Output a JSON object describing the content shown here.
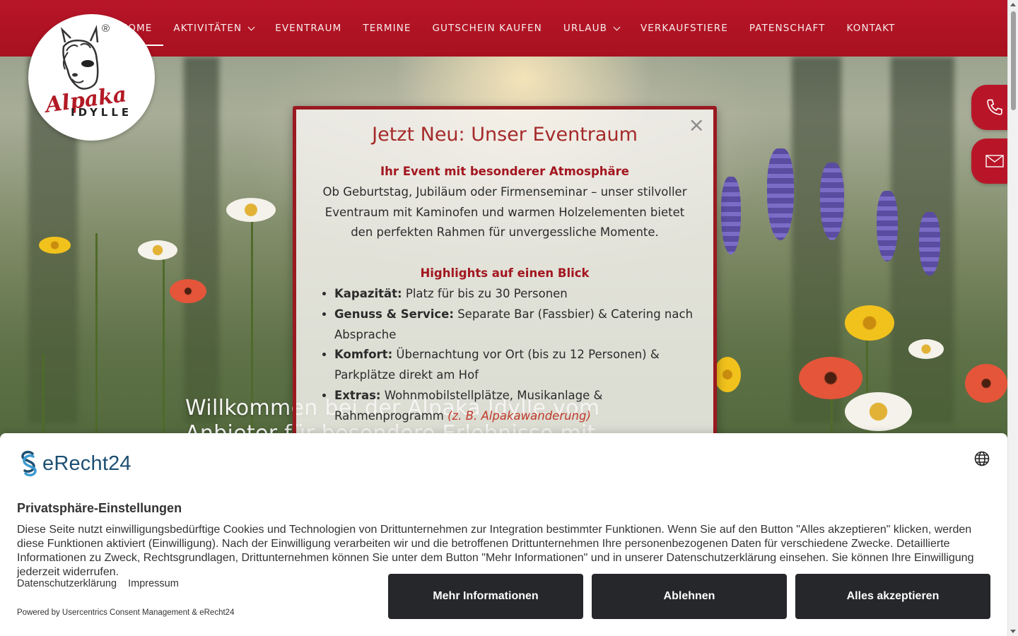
{
  "nav": {
    "items": [
      {
        "label": "HOME",
        "active": true,
        "has_dropdown": false
      },
      {
        "label": "AKTIVITÄTEN",
        "active": false,
        "has_dropdown": true
      },
      {
        "label": "EVENTRAUM",
        "active": false,
        "has_dropdown": false
      },
      {
        "label": "TERMINE",
        "active": false,
        "has_dropdown": false
      },
      {
        "label": "GUTSCHEIN KAUFEN",
        "active": false,
        "has_dropdown": false
      },
      {
        "label": "URLAUB",
        "active": false,
        "has_dropdown": true
      },
      {
        "label": "VERKAUFSTIERE",
        "active": false,
        "has_dropdown": false
      },
      {
        "label": "PATENSCHAFT",
        "active": false,
        "has_dropdown": false
      },
      {
        "label": "KONTAKT",
        "active": false,
        "has_dropdown": false
      }
    ]
  },
  "logo": {
    "word": "Alpaka",
    "sub": "IDYLLE",
    "reg": "®"
  },
  "side_buttons": {
    "phone_icon": "phone-icon",
    "mail_icon": "mail-icon"
  },
  "hero": {
    "line1": "Willkommen bei der Alpaka Idylle vom",
    "line2": "Anbieter für besondere Erlebnisse mit"
  },
  "popup": {
    "close": "×",
    "title": "Jetzt Neu: Unser Eventraum",
    "subtitle": "Ihr Event mit besonderer Atmosphäre",
    "intro": "Ob Geburtstag, Jubiläum oder Firmenseminar – unser stilvoller Eventraum mit Kaminofen und warmen Holzelementen bietet den perfekten Rahmen für unvergessliche Momente.",
    "highlights_title": "Highlights auf einen Blick",
    "highlights": [
      {
        "label": "Kapazität:",
        "text": "Platz für bis zu 30 Personen",
        "extra": ""
      },
      {
        "label": "Genuss & Service:",
        "text": "Separate Bar (Fassbier) & Catering nach Absprache",
        "extra": ""
      },
      {
        "label": "Komfort:",
        "text": "Übernachtung vor Ort (bis zu 12 Personen) & Parkplätze direkt am Hof",
        "extra": ""
      },
      {
        "label": "Extras:",
        "text": "Wohnmobilstellplätze, Musikanlage & Rahmenprogramm",
        "extra": "(z. B. Alpakawanderung)"
      }
    ]
  },
  "consent": {
    "brand": "eRecht24",
    "title": "Privatsphäre-Einstellungen",
    "text": "Diese Seite nutzt einwilligungsbedürftige Cookies und Technologien von Drittunternehmen zur Integration bestimmter Funktionen. Wenn Sie auf den Button \"Alles akzeptieren\" klicken, werden diese Funktionen aktiviert (Einwilligung). Nach der Einwilligung verarbeiten wir und die betroffenen Drittunternehmen Ihre personenbezogenen Daten für verschiedene Zwecke. Detaillierte Informationen zu Zweck, Rechtsgrundlagen, Drittunternehmen können Sie unter dem Button \"Mehr Informationen\" und in unserer Datenschutzerklärung einsehen. Sie können Ihre Einwilligung jederzeit widerrufen.",
    "link_privacy": "Datenschutzerklärung",
    "link_imprint": "Impressum",
    "powered": "Powered by Usercentrics Consent Management & eRecht24",
    "btn_more": "Mehr Informationen",
    "btn_decline": "Ablehnen",
    "btn_accept": "Alles akzeptieren",
    "language_icon": "globe-icon"
  },
  "colors": {
    "brand_red": "#b81628",
    "popup_border": "#9a1a20",
    "button_dark": "#25272a",
    "erecht_blue": "#1d4f73"
  }
}
